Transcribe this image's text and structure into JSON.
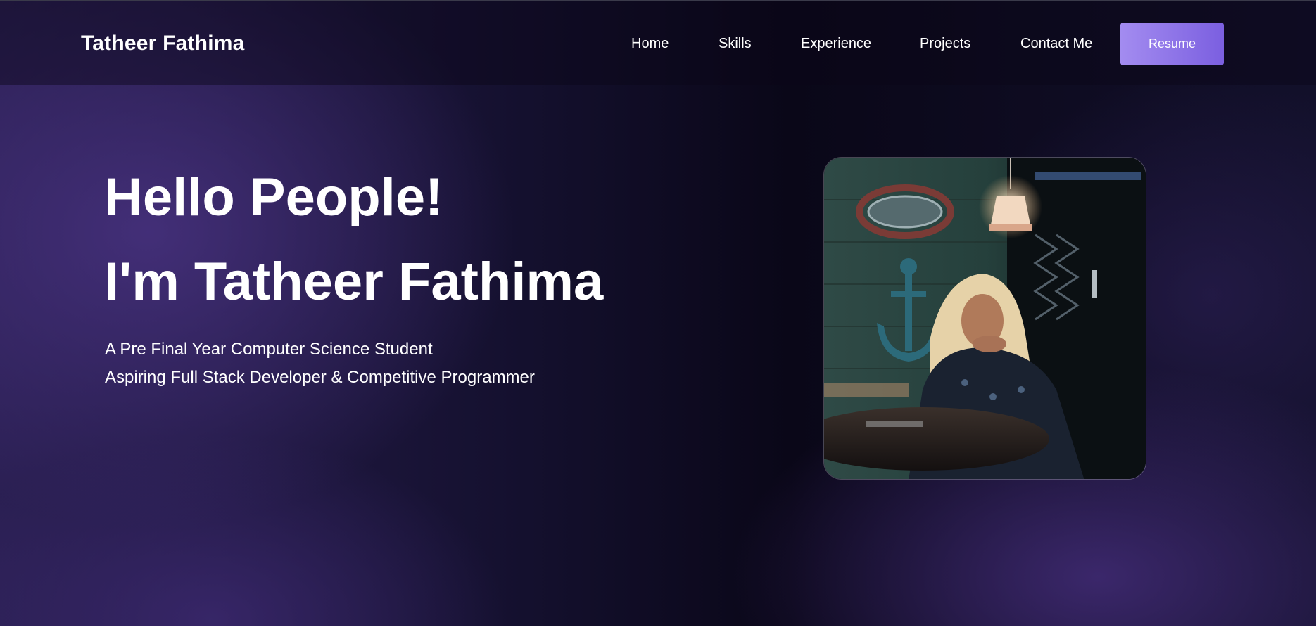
{
  "nav": {
    "brand": "Tatheer Fathima",
    "links": [
      "Home",
      "Skills",
      "Experience",
      "Projects",
      "Contact Me"
    ],
    "resume_label": "Resume"
  },
  "hero": {
    "greeting": "Hello People!",
    "intro": "I'm Tatheer Fathima",
    "subtitle_1": "A Pre Final Year Computer Science Student",
    "subtitle_2": "Aspiring Full Stack Developer & Competitive Programmer"
  },
  "colors": {
    "accent_start": "#a38cf0",
    "accent_end": "#7b5fe0",
    "background": "#0c0820"
  }
}
